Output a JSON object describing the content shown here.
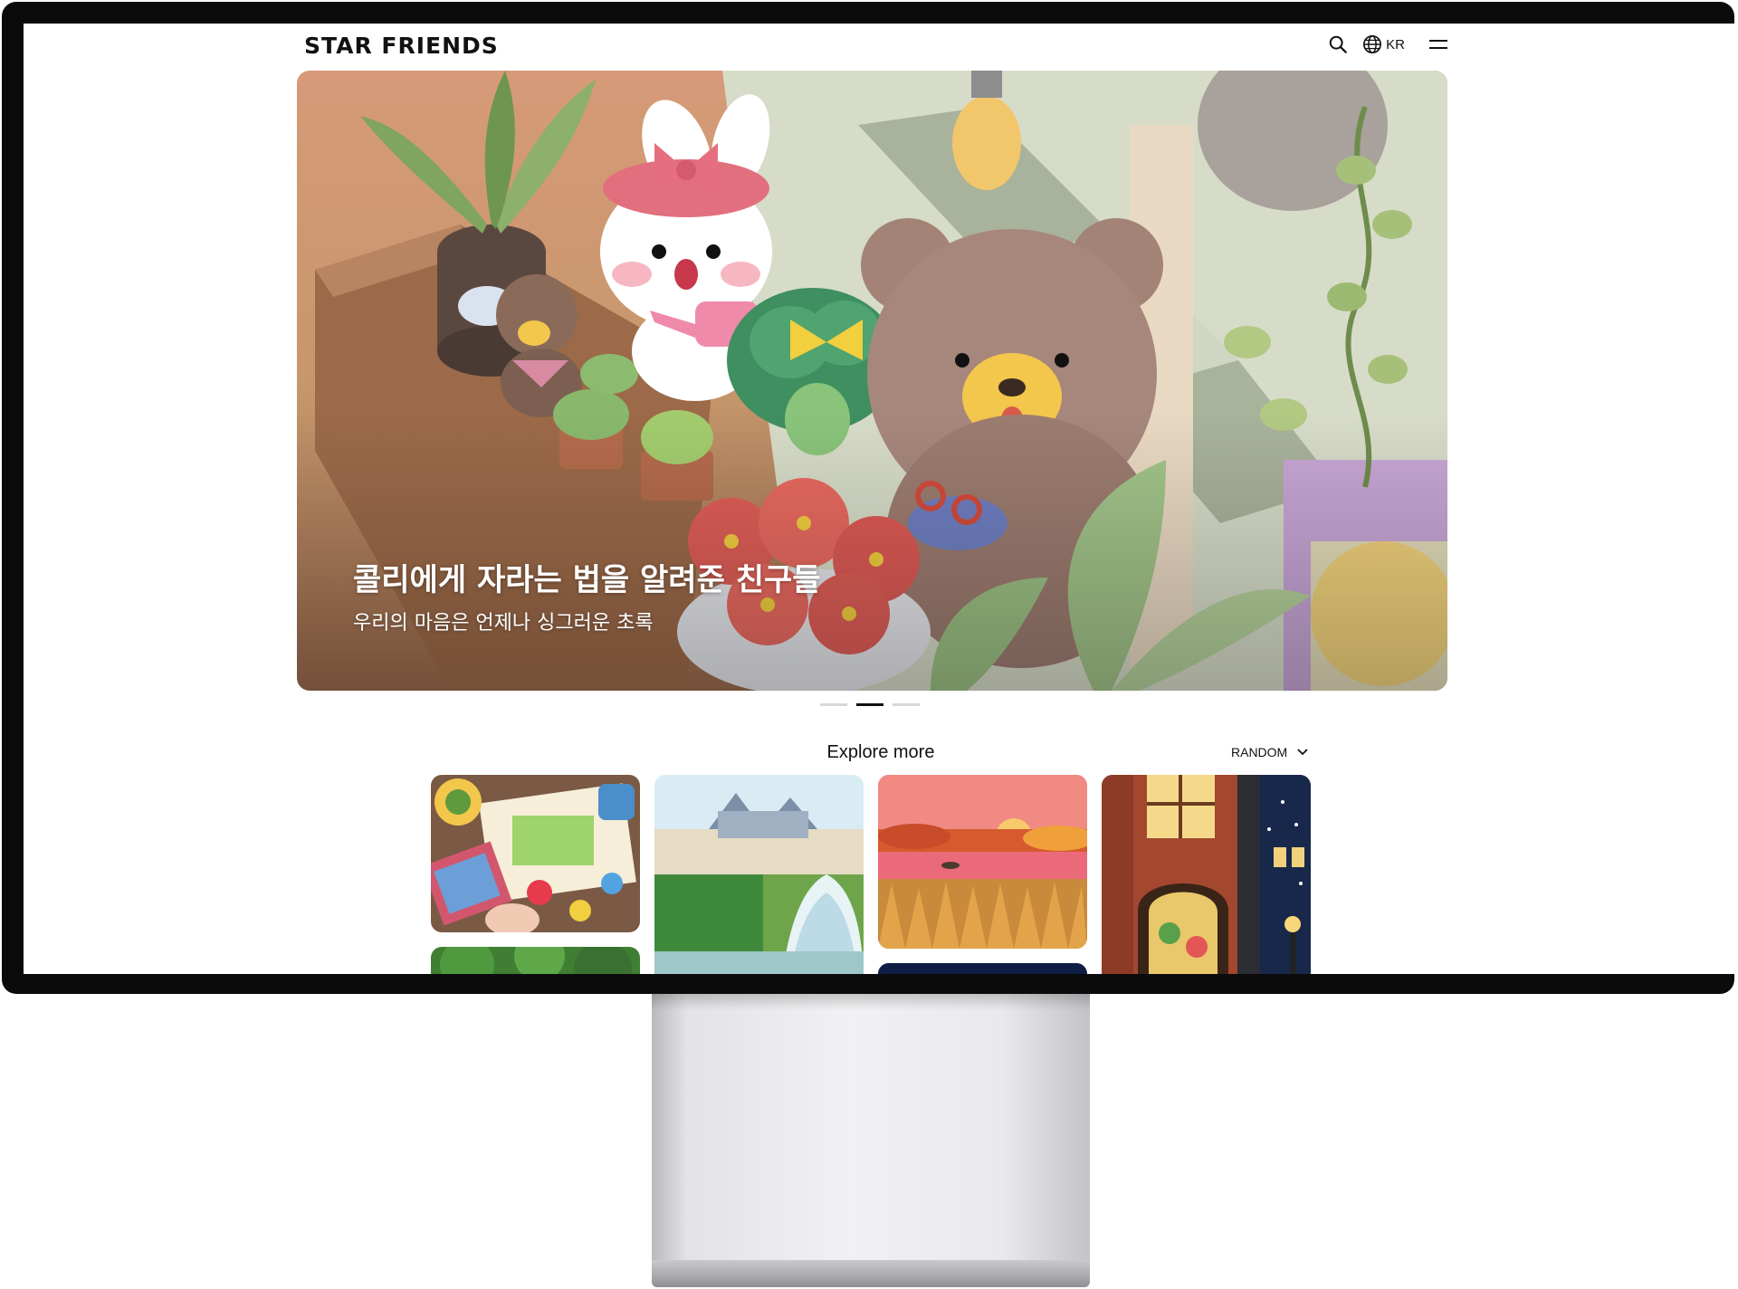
{
  "brand": {
    "logo": "STAR FRIENDS"
  },
  "header": {
    "language": "KR",
    "icons": [
      "search-icon",
      "globe-icon",
      "menu-icon"
    ]
  },
  "hero": {
    "title": "콜리에게 자라는 법을 알려준 친구들",
    "subtitle": "우리의 마음은 언제나 싱그러운 초록",
    "slides_total": 3,
    "active_slide": 2
  },
  "explore": {
    "title": "Explore more",
    "sort_label": "RANDOM"
  },
  "colors": {
    "accent": "#111111",
    "dot_inactive": "#d8d8d8"
  }
}
